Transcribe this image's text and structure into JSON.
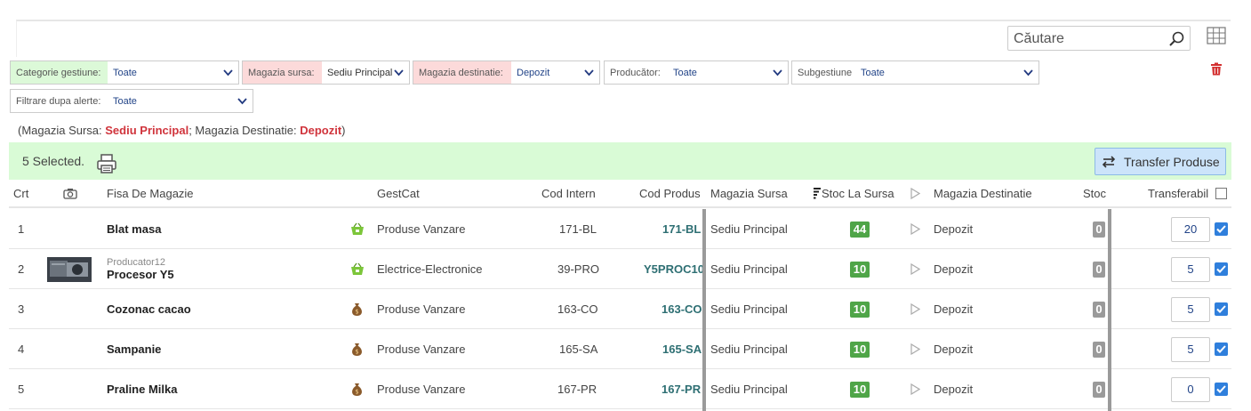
{
  "search": {
    "placeholder": "Căutare"
  },
  "filters": {
    "categorie": {
      "label": "Categorie gestiune:",
      "value": "Toate"
    },
    "sursa": {
      "label": "Magazia sursa:",
      "value": "Sediu Principal"
    },
    "destinatie": {
      "label": "Magazia destinatie:",
      "value": "Depozit"
    },
    "producator": {
      "label": "Producător:",
      "value": "Toate"
    },
    "subgestiune": {
      "label": "Subgestiune",
      "value": "Toate"
    },
    "alerte": {
      "label": "Filtrare dupa alerte:",
      "value": "Toate"
    }
  },
  "info": {
    "open": "(Magazia Sursa: ",
    "sursa": "Sediu Principal",
    "mid": "; Magazia Destinatie: ",
    "destinatie": "Depozit",
    "close": ")"
  },
  "selection": {
    "text": "5 Selected.",
    "transfer_label": "Transfer Produse"
  },
  "columns": {
    "crt": "Crt",
    "fisa": "Fisa De Magazie",
    "gestcat": "GestCat",
    "cod_intern": "Cod Intern",
    "cod_produs": "Cod Produs",
    "magazia_sursa": "Magazia Sursa",
    "stoc_sursa": "Stoc La Sursa",
    "magazia_destinatie": "Magazia Destinatie",
    "stoc": "Stoc",
    "transferabil": "Transferabil"
  },
  "rows": [
    {
      "crt": "1",
      "producer": "",
      "name": "Blat masa",
      "icon": "cart-icon",
      "gestcat": "Produse Vanzare",
      "cod_intern": "171-BL",
      "cod_produs": "171-BL",
      "sursa": "Sediu Principal",
      "stoc_sursa": "44",
      "destinatie": "Depozit",
      "stoc": "0",
      "transferabil": "20"
    },
    {
      "crt": "2",
      "producer": "Producator12",
      "name": "Procesor Y5",
      "icon": "cart-icon",
      "gestcat": "Electrice-Electronice",
      "cod_intern": "39-PRO",
      "cod_produs": "Y5PROC10",
      "sursa": "Sediu Principal",
      "stoc_sursa": "10",
      "destinatie": "Depozit",
      "stoc": "0",
      "transferabil": "5"
    },
    {
      "crt": "3",
      "producer": "",
      "name": "Cozonac cacao",
      "icon": "money-bag-icon",
      "gestcat": "Produse Vanzare",
      "cod_intern": "163-CO",
      "cod_produs": "163-CO",
      "sursa": "Sediu Principal",
      "stoc_sursa": "10",
      "destinatie": "Depozit",
      "stoc": "0",
      "transferabil": "5"
    },
    {
      "crt": "4",
      "producer": "",
      "name": "Sampanie",
      "icon": "money-bag-icon",
      "gestcat": "Produse Vanzare",
      "cod_intern": "165-SA",
      "cod_produs": "165-SA",
      "sursa": "Sediu Principal",
      "stoc_sursa": "10",
      "destinatie": "Depozit",
      "stoc": "0",
      "transferabil": "5"
    },
    {
      "crt": "5",
      "producer": "",
      "name": "Praline Milka",
      "icon": "money-bag-icon",
      "gestcat": "Produse Vanzare",
      "cod_intern": "167-PR",
      "cod_produs": "167-PR",
      "sursa": "Sediu Principal",
      "stoc_sursa": "10",
      "destinatie": "Depozit",
      "stoc": "0",
      "transferabil": "0"
    }
  ]
}
